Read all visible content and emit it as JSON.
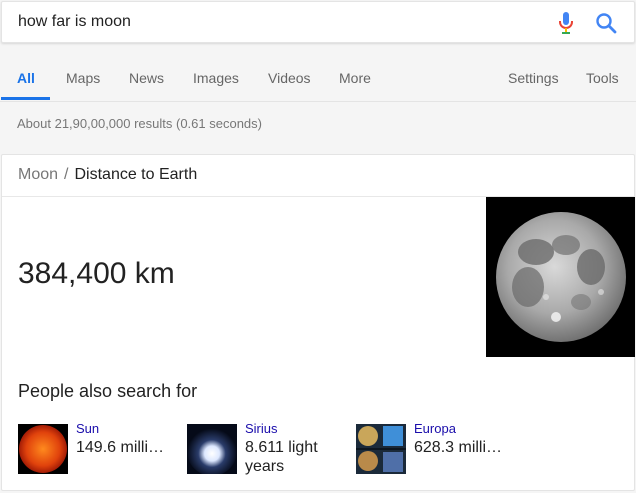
{
  "search": {
    "query": "how far is moon"
  },
  "tabs": [
    {
      "label": "All",
      "active": true
    },
    {
      "label": "Maps"
    },
    {
      "label": "News"
    },
    {
      "label": "Images"
    },
    {
      "label": "Videos"
    },
    {
      "label": "More"
    },
    {
      "label": "Settings"
    },
    {
      "label": "Tools"
    }
  ],
  "result_stats": "About 21,90,00,000 results (0.61 seconds)",
  "card": {
    "entity": "Moon",
    "separator": "/",
    "attribute": "Distance to Earth",
    "answer": "384,400 km",
    "pasf_title": "People also search for",
    "pasf": [
      {
        "name": "Sun",
        "value": "149.6 milli…",
        "thumb_icon": "sun-thumbnail"
      },
      {
        "name": "Sirius",
        "value": "8.611 light years",
        "thumb_icon": "sirius-thumbnail"
      },
      {
        "name": "Europa",
        "value": "628.3 milli…",
        "thumb_icon": "europa-thumbnail"
      }
    ]
  },
  "colors": {
    "accent_blue": "#1a73e8",
    "link_purple": "#1a0dab",
    "mic_blue": "#4285f4",
    "mic_red": "#ea4335",
    "mic_yellow": "#fbbc05",
    "mic_green": "#34a853"
  }
}
